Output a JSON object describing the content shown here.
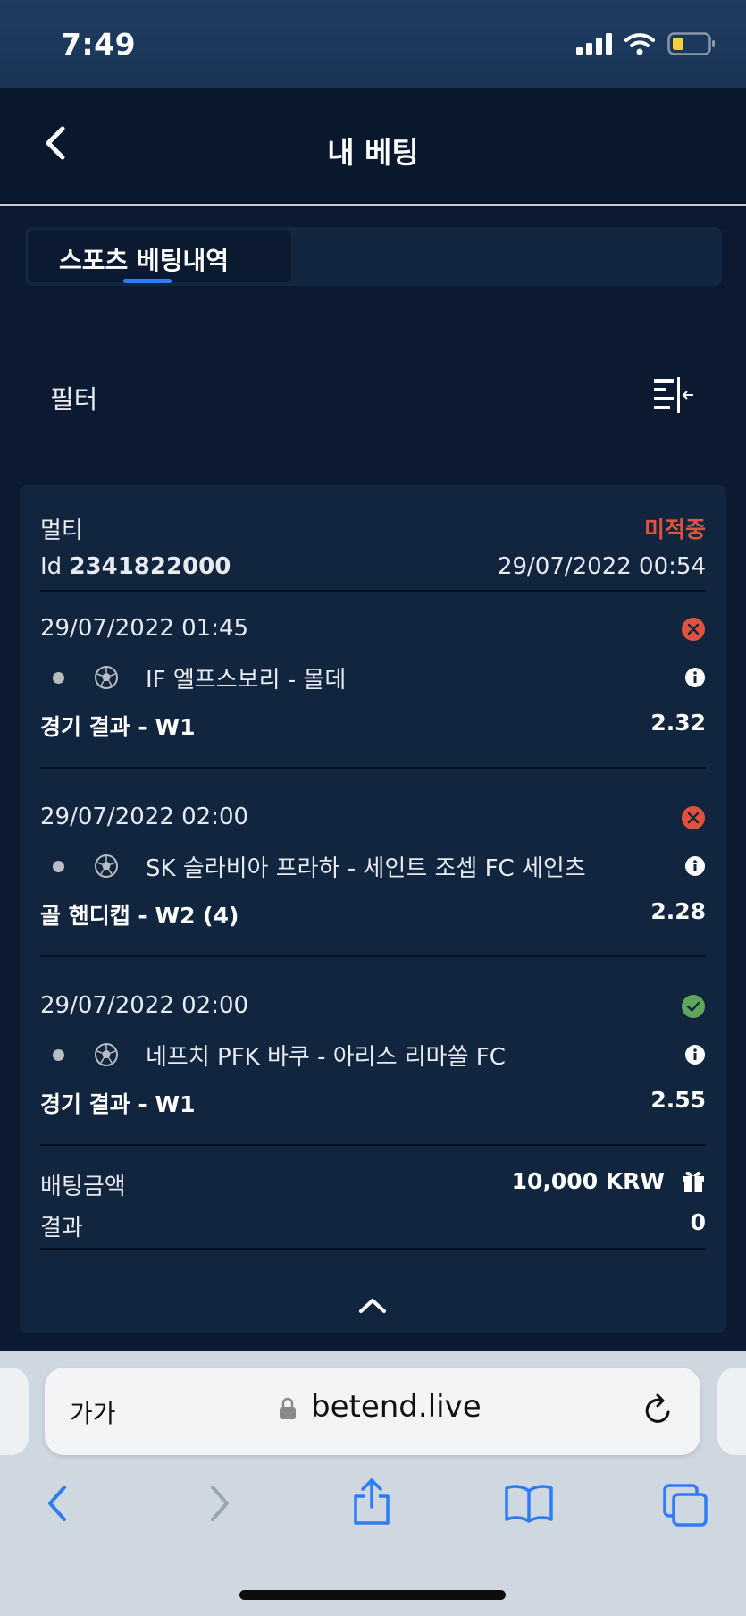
{
  "status_bar": {
    "time": "7:49",
    "icons": [
      "signal-icon",
      "wifi-icon",
      "battery-icon"
    ],
    "battery_color": "#f5d23a"
  },
  "header": {
    "title": "내 베팅",
    "back_icon": "chevron-left-icon"
  },
  "tabs": [
    {
      "label": "스포츠 베팅내역",
      "active": true,
      "accent": "#2f7cf6"
    }
  ],
  "filter": {
    "label": "필터",
    "icon": "filter-collapse-icon"
  },
  "bet": {
    "type": "멀티",
    "status": "미적중",
    "status_color": "#e0523e",
    "id_label": "Id",
    "id_value": "2341822000",
    "placed_at": "29/07/2022 00:54",
    "selections": [
      {
        "datetime": "29/07/2022 01:45",
        "result": "lost",
        "match": "IF 엘프스보리 - 몰데",
        "market": "경기 결과 - W1",
        "odds": "2.32"
      },
      {
        "datetime": "29/07/2022 02:00",
        "result": "lost",
        "match": "SK 슬라비아 프라하 - 세인트 조셉 FC 세인츠",
        "market": "골 핸디캡 - W2 (4)",
        "odds": "2.28"
      },
      {
        "datetime": "29/07/2022 02:00",
        "result": "won",
        "match": "네프치 PFK 바쿠 - 아리스 리마쏠 FC",
        "market": "경기 결과 - W1",
        "odds": "2.55"
      }
    ],
    "result_colors": {
      "lost": "#e0523e",
      "won": "#5fa65a"
    },
    "stake_label": "배팅금액",
    "stake_value": "10,000 KRW",
    "result_label": "결과",
    "result_value": "0"
  },
  "browser": {
    "text_size_button": "가가",
    "url": "betend.live",
    "toolbar": [
      "back-icon",
      "forward-icon",
      "share-icon",
      "bookmarks-icon",
      "tabs-icon"
    ],
    "accent": "#2f7cf6"
  }
}
